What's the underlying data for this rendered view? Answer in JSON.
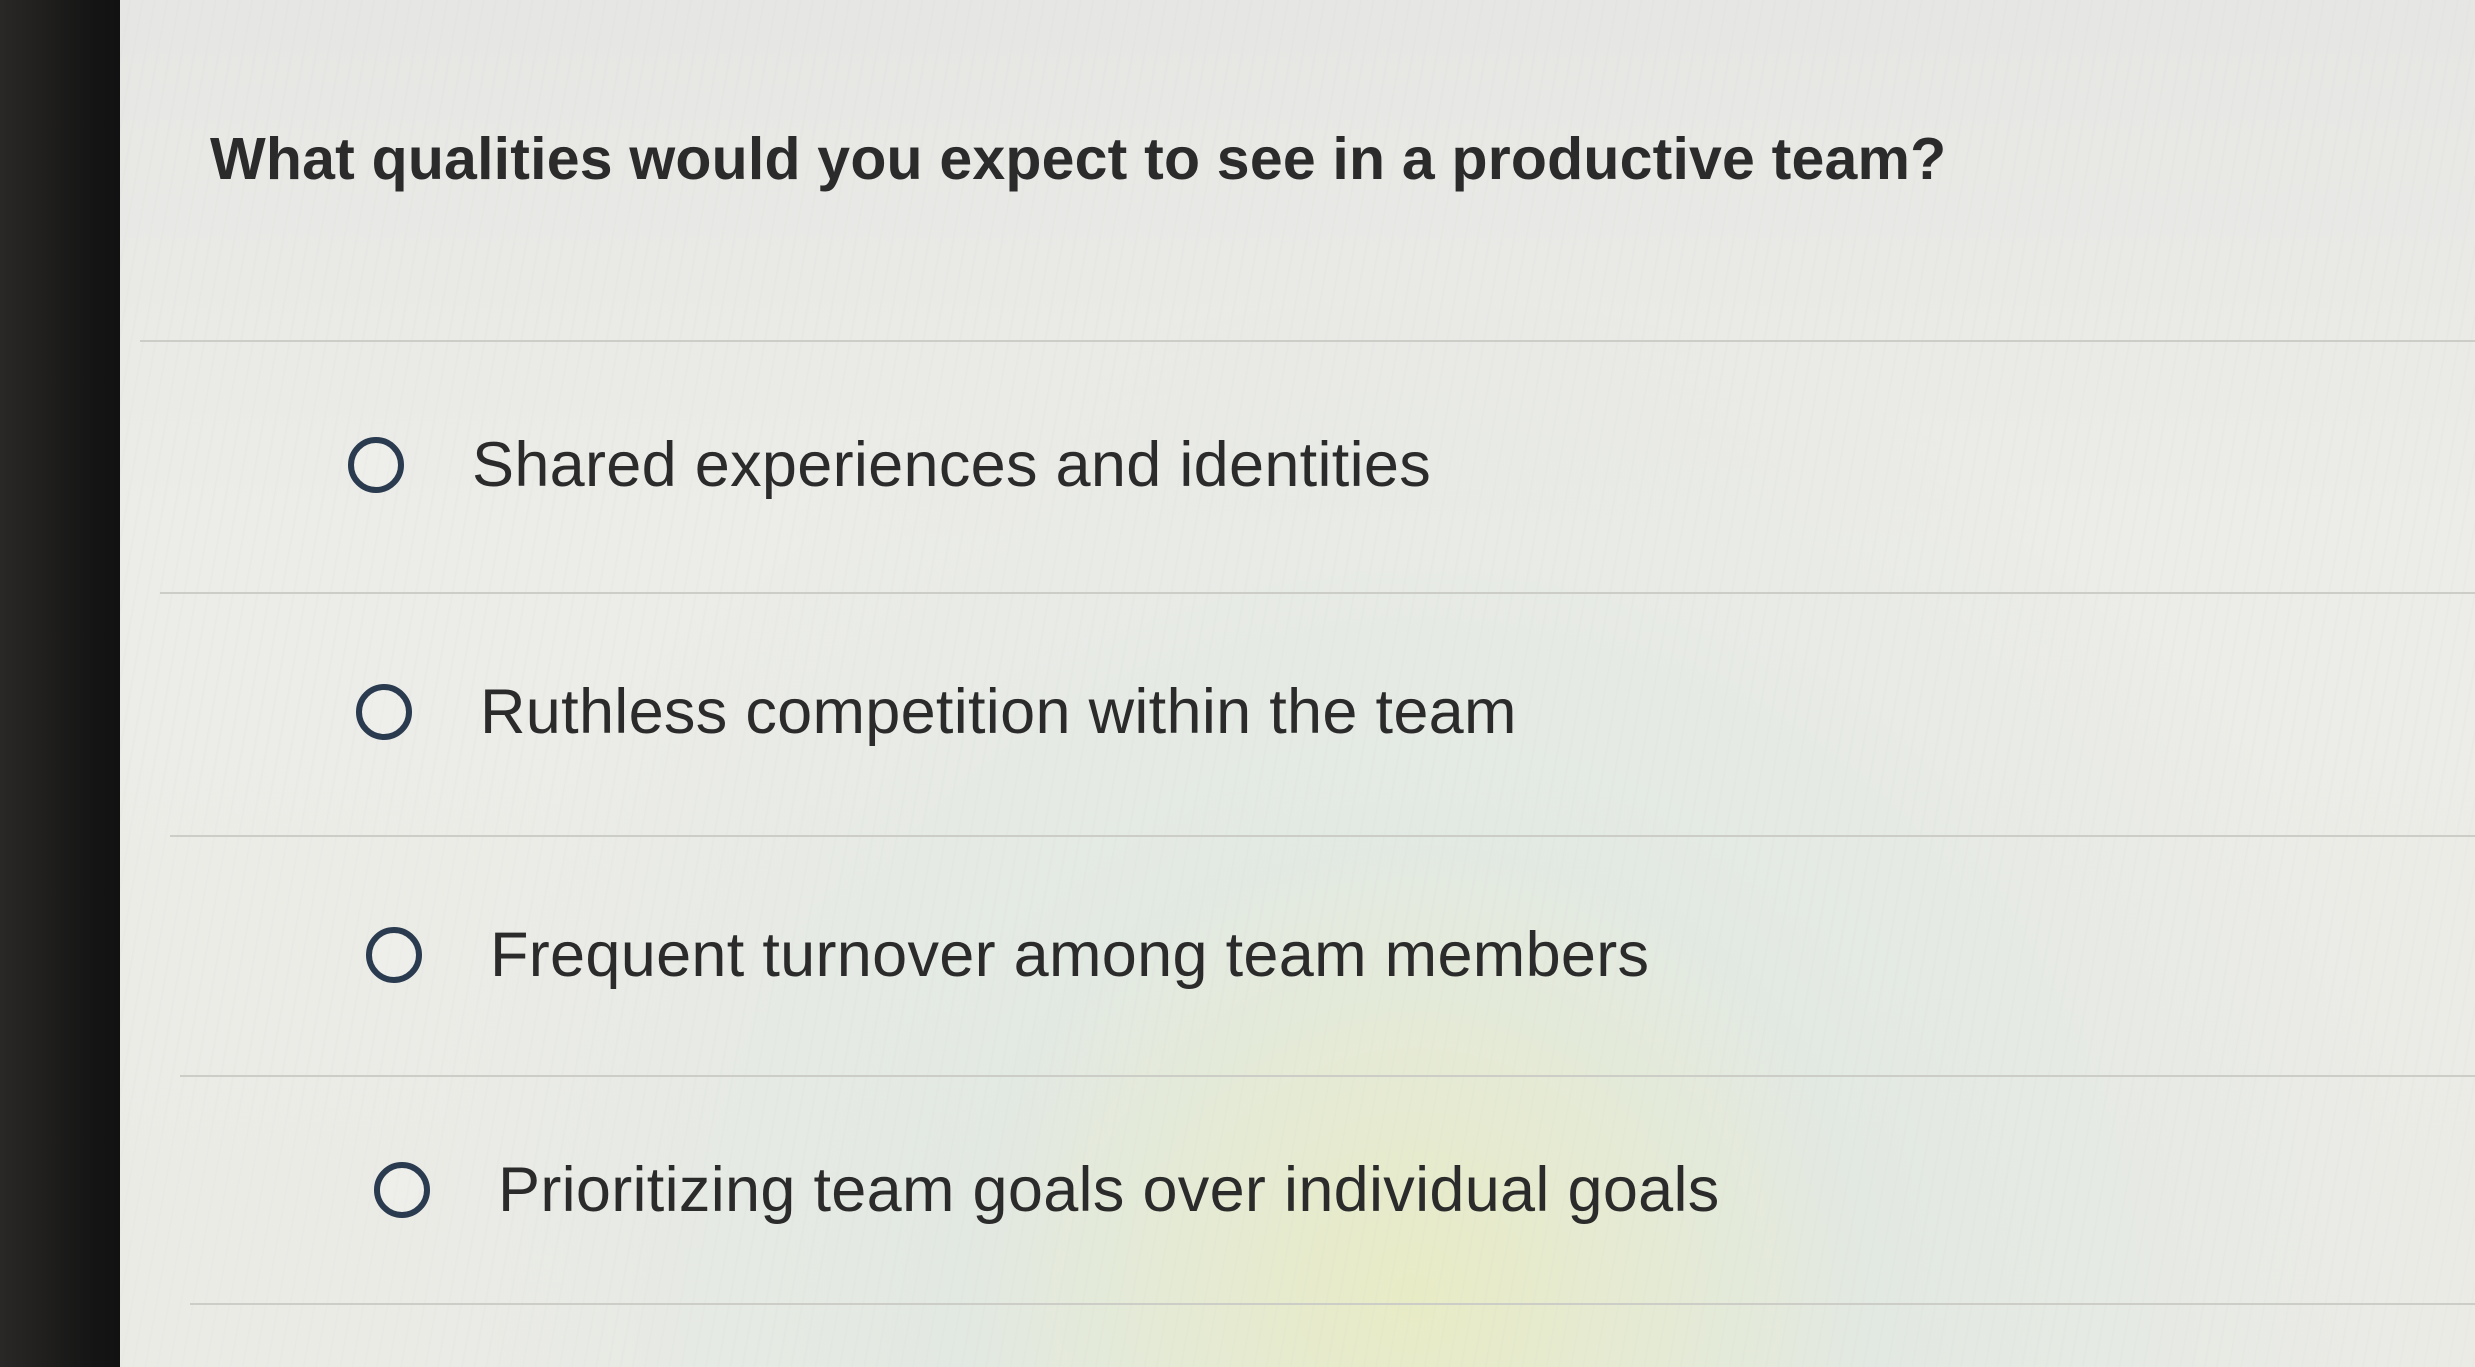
{
  "question": {
    "text": "What qualities would you expect to see in a productive team?"
  },
  "options": [
    {
      "label": "Shared experiences and identities",
      "selected": false
    },
    {
      "label": "Ruthless competition within the team",
      "selected": false
    },
    {
      "label": "Frequent turnover among team members",
      "selected": false
    },
    {
      "label": "Prioritizing team goals over individual goals",
      "selected": false
    }
  ],
  "colors": {
    "radio_border": "#2a3a4f",
    "text": "#2b2b2b",
    "background": "#ebebe6"
  }
}
